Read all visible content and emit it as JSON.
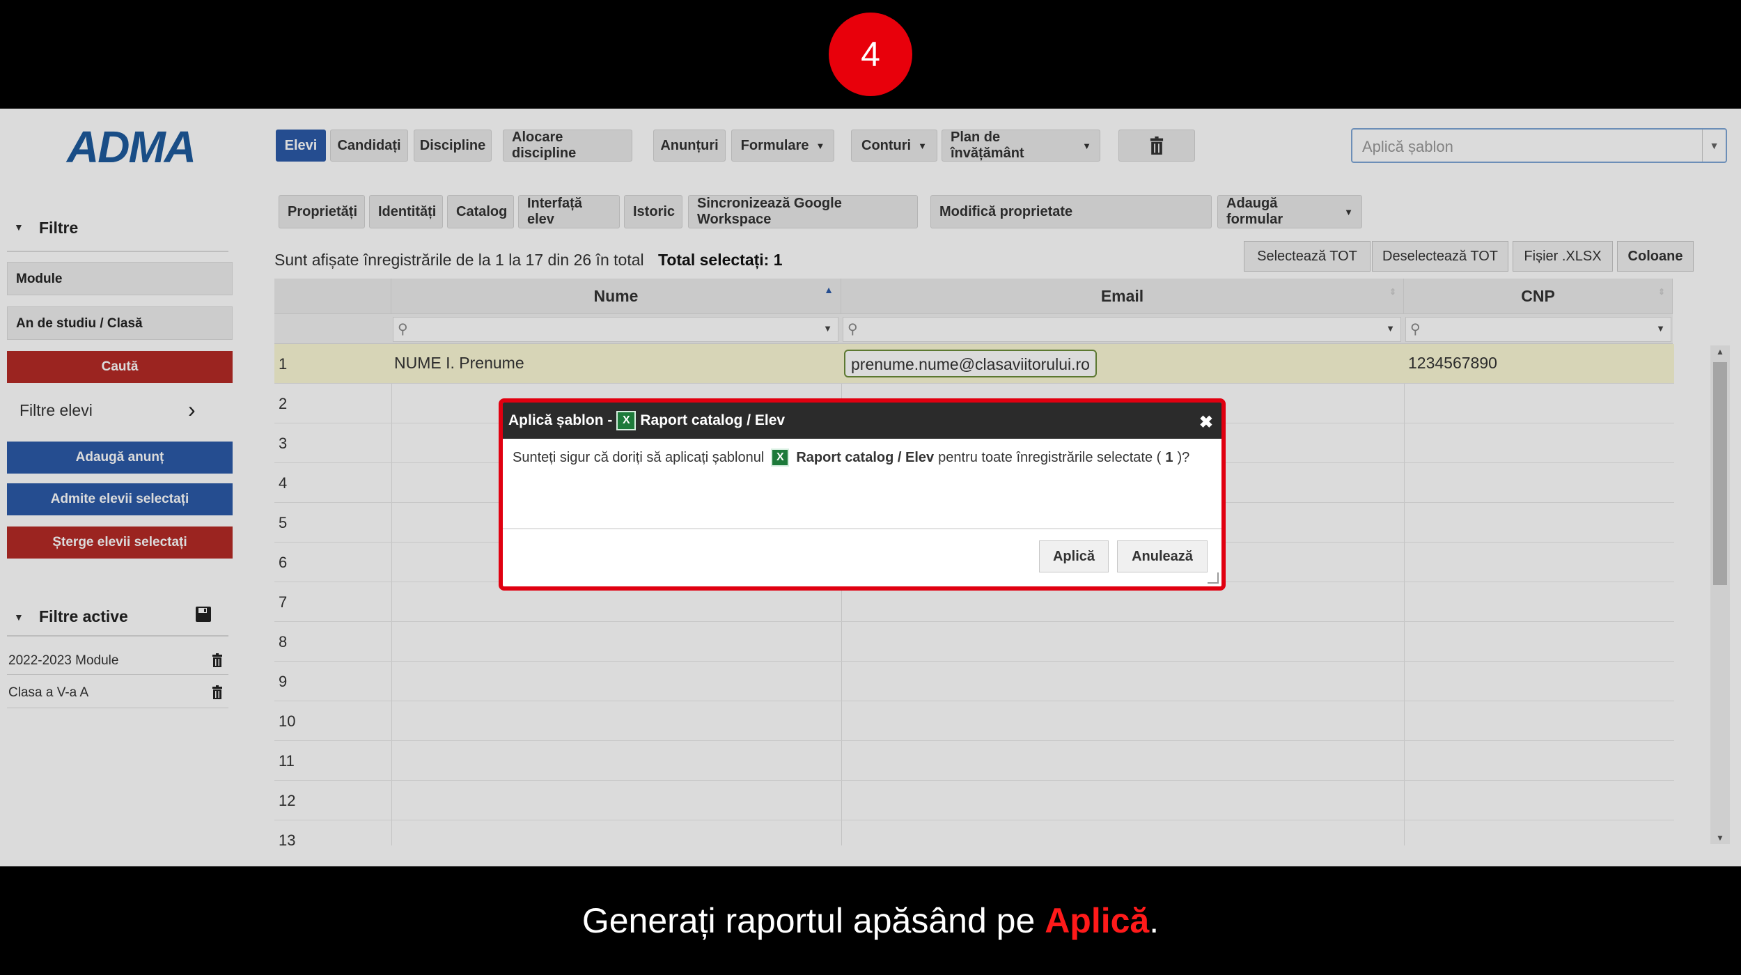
{
  "step": "4",
  "caption": {
    "prefix": "Generați raportul apăsând pe ",
    "highlight": "Aplică",
    "suffix": "."
  },
  "app": {
    "logo": "ADMA",
    "nav": [
      "Elevi",
      "Candidați",
      "Discipline",
      "Alocare discipline",
      "Anunțuri",
      "Formulare",
      "Conturi",
      "Plan de învățământ"
    ],
    "template_placeholder": "Aplică șablon",
    "subnav": [
      "Proprietăți",
      "Identități",
      "Catalog",
      "Interfață elev",
      "Istoric",
      "Sincronizează Google Workspace",
      "Modifică proprietate",
      "Adaugă formular"
    ],
    "sidebar": {
      "filters_title": "Filtre",
      "modules": "Module",
      "study_year": "An de studiu / Clasă",
      "search": "Caută",
      "student_filters": "Filtre elevi",
      "add_announcement": "Adaugă anunț",
      "admit_selected": "Admite elevii selectați",
      "delete_selected": "Șterge elevii selectați",
      "active_filters_title": "Filtre active",
      "active_filters": [
        "2022-2023 Module",
        "Clasa a V-a A"
      ]
    },
    "info_text": "Sunt afișate înregistrările de la 1 la 17 din 26 în total",
    "total_selected": "Total selectați: 1",
    "toolbar": [
      "Selectează TOT",
      "Deselectează TOT",
      "Fișier .XLSX",
      "Coloane"
    ],
    "columns": [
      "Nume",
      "Email",
      "CNP"
    ],
    "rows": [
      {
        "n": "1",
        "nume": "NUME I. Prenume",
        "email": "prenume.nume@clasaviitorului.ro",
        "cnp": "1234567890"
      },
      {
        "n": "2"
      },
      {
        "n": "3"
      },
      {
        "n": "4"
      },
      {
        "n": "5"
      },
      {
        "n": "6"
      },
      {
        "n": "7"
      },
      {
        "n": "8"
      },
      {
        "n": "9"
      },
      {
        "n": "10"
      },
      {
        "n": "11"
      },
      {
        "n": "12"
      },
      {
        "n": "13"
      }
    ],
    "dialog": {
      "title_prefix": "Aplică șablon -",
      "template_name": "Raport catalog / Elev",
      "message_prefix": "Sunteți sigur că doriți să aplicați șablonul",
      "message_suffix": "pentru toate înregistrările selectate (",
      "count": "1",
      "message_end": ")?",
      "apply": "Aplică",
      "cancel": "Anulează"
    }
  }
}
